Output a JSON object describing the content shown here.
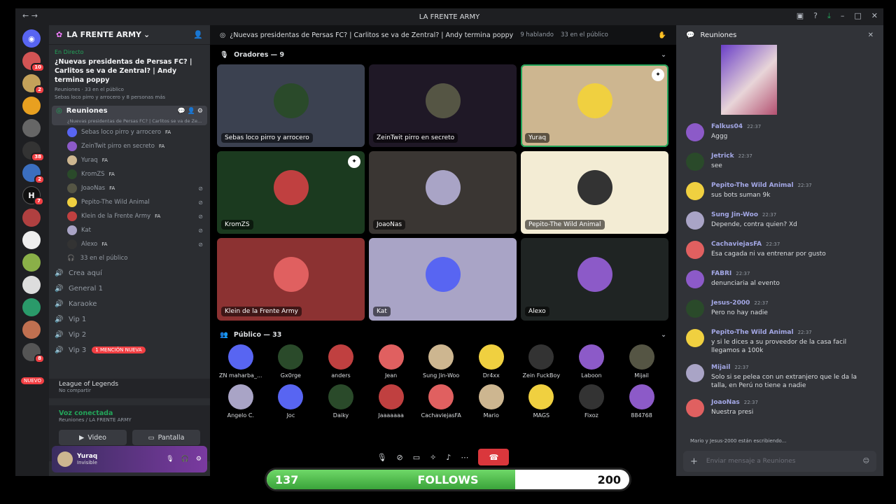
{
  "window": {
    "title": "LA FRENTE ARMY"
  },
  "servers": {
    "badges": [
      "10",
      "2",
      "38",
      "2",
      "7",
      "8"
    ],
    "new_label": "NUEVO"
  },
  "guild": {
    "name": "LA FRENTE ARMY"
  },
  "live": {
    "tag": "En Directo",
    "title": "¿Nuevas presidentas de Persas FC? | Carlitos se va de Zentral? | Andy termina poppy",
    "channel": "Reuniones",
    "audience": "33 en el público",
    "speakers": "Sebas loco pirro y arrocero y 8 personas más"
  },
  "active_channel": {
    "name": "Reuniones",
    "sub": "¿Nuevas presidentas de Persas FC? | Carlitos se va de Ze..."
  },
  "channel_users": [
    {
      "name": "Sebas loco pirro y arrocero",
      "fa": "FA",
      "muted": false
    },
    {
      "name": "ZeinTwit pirro en secreto",
      "fa": "FA",
      "muted": false
    },
    {
      "name": "Yuraq",
      "fa": "FA",
      "muted": false
    },
    {
      "name": "KromZS",
      "fa": "FA",
      "muted": false
    },
    {
      "name": "JoaoNas",
      "fa": "FA",
      "muted": true
    },
    {
      "name": "Pepito-The Wild Animal",
      "fa": "",
      "muted": true
    },
    {
      "name": "Klein de la Frente Army",
      "fa": "FA",
      "muted": true
    },
    {
      "name": "Kat",
      "fa": "",
      "muted": true
    },
    {
      "name": "Alexo",
      "fa": "FA",
      "muted": true
    }
  ],
  "channel_audience": "33 en el público",
  "voice_channels": [
    {
      "name": "Crea aquí"
    },
    {
      "name": "General 1"
    },
    {
      "name": "Karaoke"
    },
    {
      "name": "Vip 1"
    },
    {
      "name": "Vip 2"
    },
    {
      "name": "Vip 3",
      "mention": "1 MENCIÓN NUEVA"
    }
  ],
  "activity": {
    "game": "League of Legends",
    "status": "No compartir"
  },
  "voice": {
    "connected": "Voz conectada",
    "location": "Reuniones / LA FRENTE ARMY",
    "video": "Video",
    "screen": "Pantalla"
  },
  "me": {
    "name": "Yuraq",
    "status": "Invisible"
  },
  "stage": {
    "title": "¿Nuevas presidentas de Persas FC? | Carlitos se va de Zentral? | Andy termina poppy",
    "speaking": "9 hablando",
    "audience": "33 en el público"
  },
  "speakers_header": "Oradores — 9",
  "speakers": [
    {
      "name": "Sebas loco pirro y arrocero",
      "bg": "#3b4150"
    },
    {
      "name": "ZeinTwit pirro en secreto",
      "bg": "#1f1826"
    },
    {
      "name": "Yuraq",
      "bg": "#cdb690"
    },
    {
      "name": "KromZS",
      "bg": "#1b3a1f"
    },
    {
      "name": "JoaoNas",
      "bg": "#3a3633"
    },
    {
      "name": "Pepito-The Wild Animal",
      "bg": "#f3ecd4"
    },
    {
      "name": "Klein de la Frente Army",
      "bg": "#8c3232"
    },
    {
      "name": "Kat",
      "bg": "#a9a4c6"
    },
    {
      "name": "Alexo",
      "bg": "#1f2423"
    }
  ],
  "public_header": "Público — 33",
  "public": [
    "ZN maharba_...",
    "Gx0rge",
    "anders",
    "Jean",
    "Sung Jin-Woo",
    "Dr4xx",
    "Zein FuckBoy",
    "Laboon",
    "Mijail",
    "Angelo C.",
    "Joc",
    "Daiky",
    "Jaaaaaaa",
    "CachaviejasFA",
    "Mario",
    "MAGS",
    "Fixoz",
    "884768"
  ],
  "chat": {
    "title": "Reuniones",
    "placeholder": "Enviar mensaje a Reuniones",
    "typing": "Mario y Jesus-2000 están escribiendo...",
    "messages": [
      {
        "author": "Falkus04",
        "time": "22:37",
        "text": "Aggg"
      },
      {
        "author": "Jetrick",
        "time": "22:37",
        "text": "see"
      },
      {
        "author": "Pepito-The Wild Animal",
        "time": "22:37",
        "text": "sus bots suman 9k"
      },
      {
        "author": "Sung Jin-Woo",
        "time": "22:37",
        "text": "Depende, contra quien? Xd"
      },
      {
        "author": "CachaviejasFA",
        "time": "22:37",
        "text": "Esa cagada ni va entrenar por gusto"
      },
      {
        "author": "FABRI",
        "time": "22:37",
        "text": "denunciaria al evento"
      },
      {
        "author": "Jesus-2000",
        "time": "22:37",
        "text": "Pero no hay nadie"
      },
      {
        "author": "Pepito-The Wild Animal",
        "time": "22:37",
        "text": "y si le dices a su proveedor de la casa facil llegamos a 100k"
      },
      {
        "author": "Mijail",
        "time": "22:37",
        "text": "Solo si se pelea con un extranjero que le da la talla, en Perú no tiene a nadie"
      },
      {
        "author": "JoaoNas",
        "time": "22:37",
        "text": "Nuestra presi"
      }
    ]
  },
  "follows": {
    "current": "137",
    "label": "FOLLOWS",
    "goal": "200",
    "progress": 0.685
  }
}
